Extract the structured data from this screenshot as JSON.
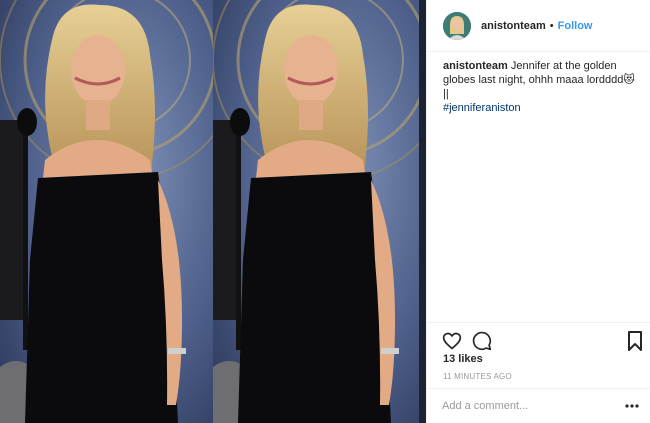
{
  "header": {
    "username": "anistonteam",
    "separator": "•",
    "follow_label": "Follow"
  },
  "caption": {
    "username": "anistonteam",
    "line1": "Jennifer at the golden globes last night, ohhh maaa lordddd😻",
    "line2": "||",
    "hashtag": "#jenniferaniston"
  },
  "engagement": {
    "likes": "13 likes",
    "timestamp": "11 MINUTES AGO"
  },
  "comment_box": {
    "placeholder": "Add a comment..."
  },
  "icons": {
    "like": "heart-icon",
    "comment": "comment-icon",
    "save": "bookmark-icon",
    "options": "more-options-icon"
  },
  "colors": {
    "follow_link": "#3897f0",
    "hashtag": "#003569",
    "timestamp": "#999999"
  }
}
